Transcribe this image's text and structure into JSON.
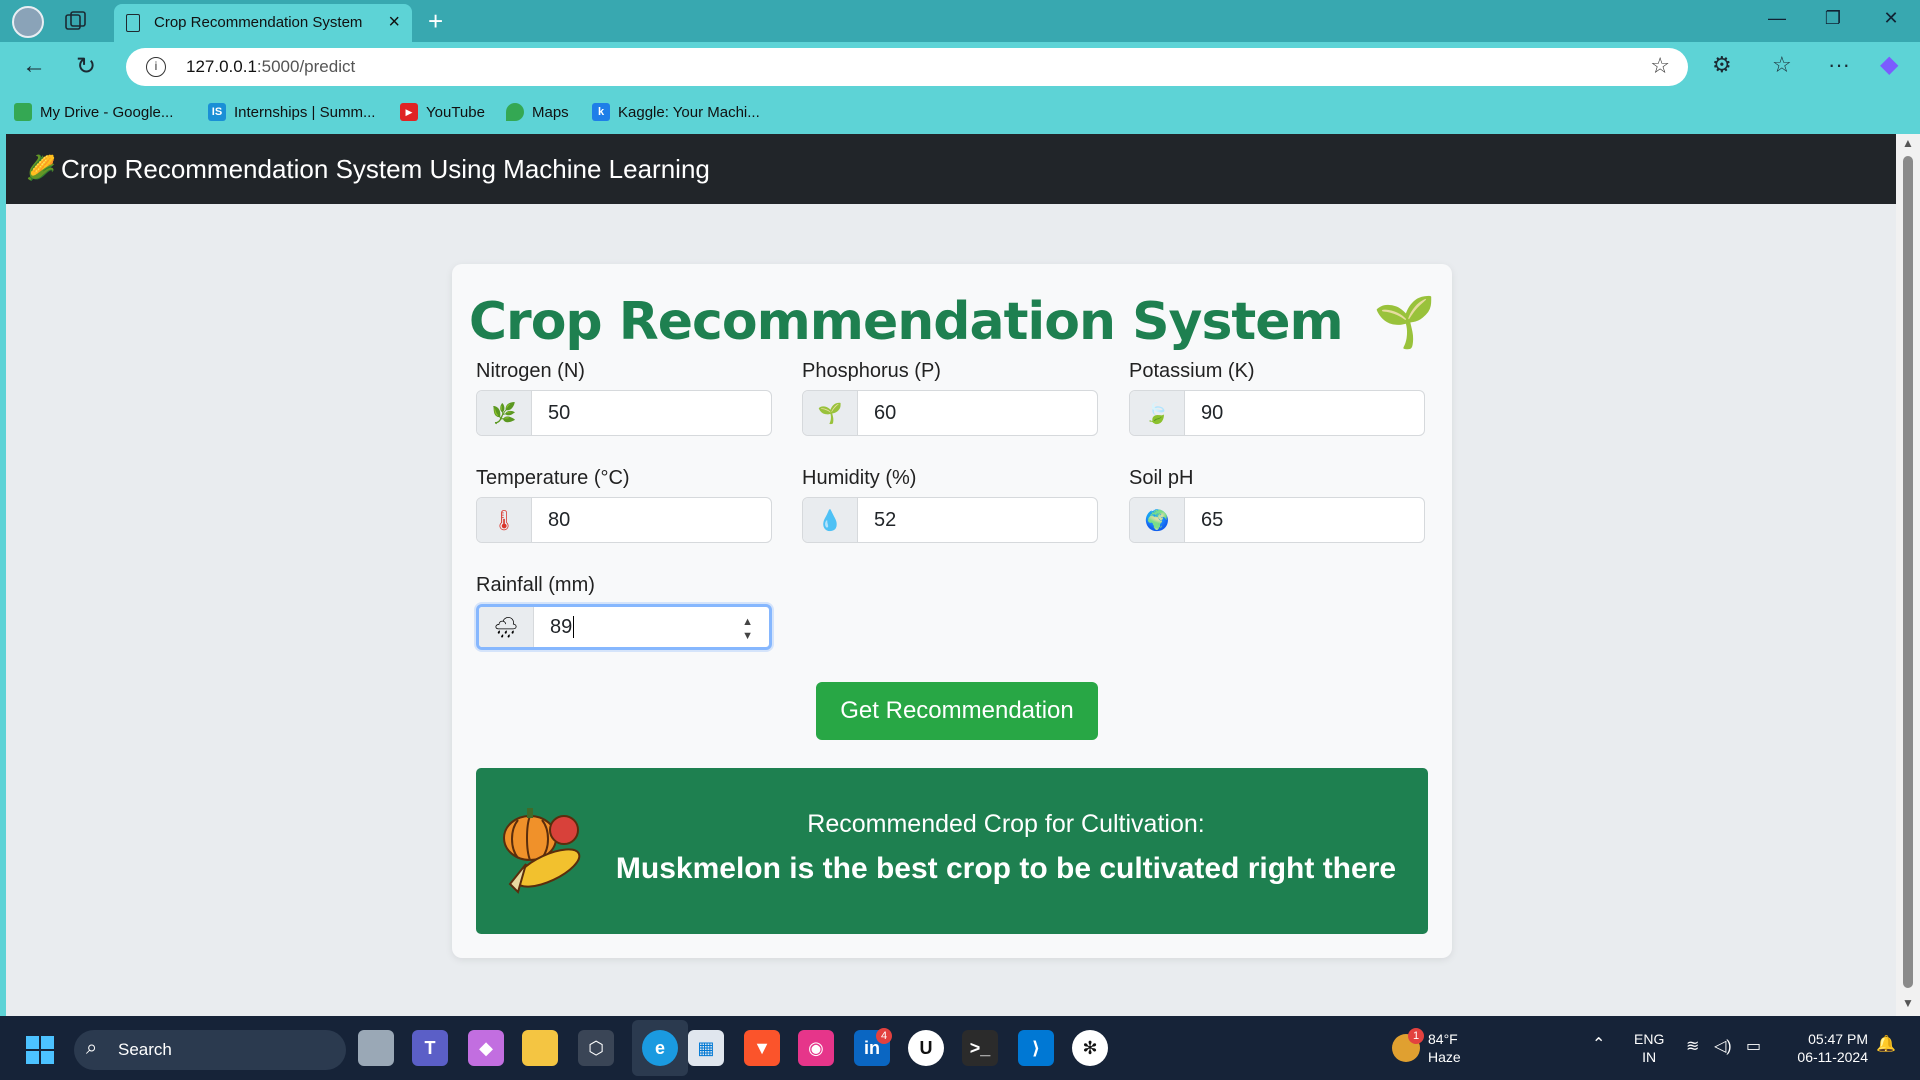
{
  "browser": {
    "tab_title": "Crop Recommendation System",
    "url_host": "127.0.0.1",
    "url_path": ":5000/predict",
    "bookmarks": [
      {
        "label": "My Drive - Google...",
        "icon": "google-drive-icon",
        "color": "#34a853"
      },
      {
        "label": "Internships | Summ...",
        "icon": "internshala-icon",
        "color": "#1a8fd6"
      },
      {
        "label": "YouTube",
        "icon": "youtube-icon",
        "color": "#e02424"
      },
      {
        "label": "Maps",
        "icon": "google-maps-icon",
        "color": "#34a853"
      },
      {
        "label": "Kaggle: Your Machi...",
        "icon": "kaggle-icon",
        "color": "#1e7ee8"
      }
    ]
  },
  "app": {
    "brand": "Crop Recommendation System Using Machine Learning",
    "title": "Crop Recommendation System",
    "title_icon": "🌱",
    "fields": [
      {
        "label": "Nitrogen (N)",
        "value": "50",
        "icon": "🌿"
      },
      {
        "label": "Phosphorus (P)",
        "value": "60",
        "icon": "🌱"
      },
      {
        "label": "Potassium (K)",
        "value": "90",
        "icon": "🍃"
      },
      {
        "label": "Temperature (°C)",
        "value": "80",
        "icon": "🌡"
      },
      {
        "label": "Humidity (%)",
        "value": "52",
        "icon": "💧"
      },
      {
        "label": "Soil pH",
        "value": "65",
        "icon": "🌍"
      },
      {
        "label": "Rainfall (mm)",
        "value": "89",
        "icon": "🌧"
      }
    ],
    "button_label": "Get Recommendation",
    "result": {
      "heading": "Recommended Crop for Cultivation:",
      "text": "Muskmelon is the best crop to be cultivated right there"
    }
  },
  "taskbar": {
    "search_label": "Search",
    "weather_temp": "84°F",
    "weather_cond": "Haze",
    "weather_badge": "1",
    "linkedin_badge": "4",
    "lang_top": "ENG",
    "lang_bottom": "IN",
    "time": "05:47 PM",
    "date": "06-11-2024"
  },
  "colors": {
    "accent_green": "#1e8050",
    "button_green": "#28a745",
    "header_dark": "#212529",
    "browser_teal": "#5dd3d6"
  }
}
